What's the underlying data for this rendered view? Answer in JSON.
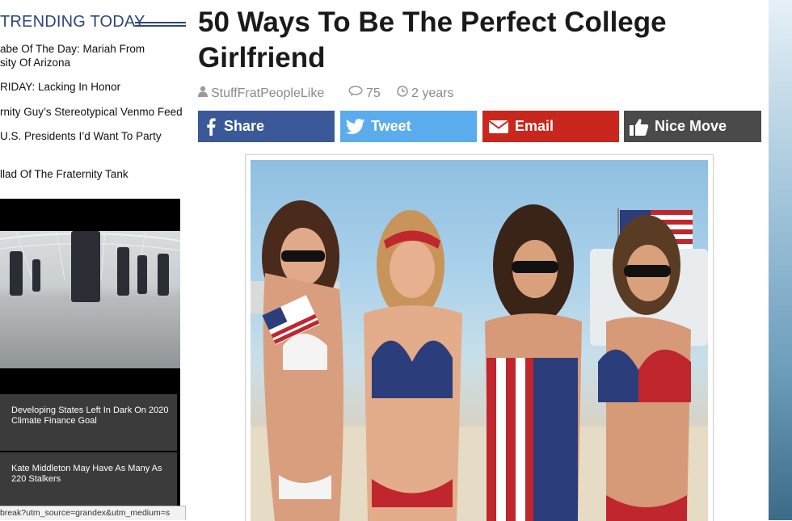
{
  "sidebar": {
    "trending_title": "TRENDING TODAY",
    "items": [
      {
        "line1": "abe Of The Day: Mariah From",
        "line2": "sity Of Arizona"
      },
      {
        "line1": "RIDAY: Lacking In Honor",
        "line2": ""
      },
      {
        "line1": "rnity Guy’s Stereotypical Venmo Feed",
        "line2": ""
      },
      {
        "line1": "U.S. Presidents I’d Want To Party",
        "line2": ""
      },
      {
        "line1": "llad Of The Fraternity Tank",
        "line2": ""
      }
    ],
    "video_cards": [
      {
        "text": "Developing States Left In Dark On 2020 Climate Finance Goal"
      },
      {
        "text": "Kate Middleton May Have As Many As 220 Stalkers"
      }
    ],
    "status_url": "break?utm_source=grandex&utm_medium=s"
  },
  "article": {
    "title": "50 Ways To Be The Perfect College Girlfriend",
    "author": "StuffFratPeopleLike",
    "comments": "75",
    "age": "2 years"
  },
  "share": {
    "facebook_label": "Share",
    "twitter_label": "Tweet",
    "email_label": "Email",
    "nice_label": "Nice Move"
  },
  "colors": {
    "facebook": "#3b5998",
    "twitter": "#5aacec",
    "email": "#c9261e",
    "nice": "#4a4a4a",
    "trending": "#2e4677"
  },
  "icons": {
    "author": "user-icon",
    "comments": "comment-icon",
    "age": "clock-icon",
    "facebook": "facebook-icon",
    "twitter": "twitter-icon",
    "email": "envelope-icon",
    "nice": "thumbs-up-icon"
  }
}
